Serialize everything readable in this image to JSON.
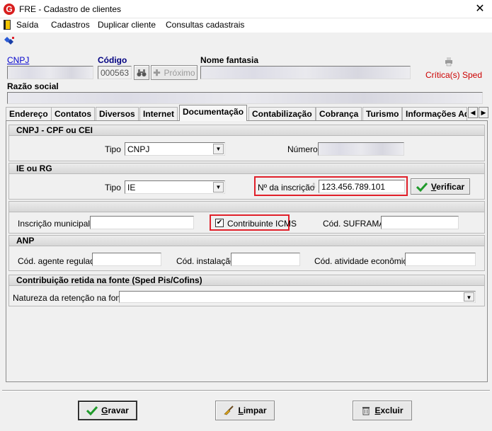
{
  "window": {
    "title": "FRE - Cadastro de clientes",
    "logo_letter": "G",
    "close_glyph": "✕"
  },
  "menu": {
    "items": [
      "Saída",
      "Cadastros",
      "Duplicar cliente",
      "Consultas cadastrais"
    ]
  },
  "header": {
    "cnpj_label": "CNPJ",
    "codigo_label": "Código",
    "codigo_value": "000563",
    "proximo_label": "Próximo",
    "nome_fantasia_label": "Nome fantasia",
    "sped_label": "Crítica(s) Sped",
    "razao_social_label": "Razão social"
  },
  "tabs": [
    {
      "label": "Endereço"
    },
    {
      "label": "Contatos"
    },
    {
      "label": "Diversos"
    },
    {
      "label": "Internet"
    },
    {
      "label": "Documentação"
    },
    {
      "label": "Contabilização"
    },
    {
      "label": "Cobrança"
    },
    {
      "label": "Turismo"
    },
    {
      "label": "Informações Ad"
    }
  ],
  "tab_scroll": {
    "left": "◀",
    "right": "▶"
  },
  "cnpj_section": {
    "title": "CNPJ - CPF ou CEI",
    "tipo_label": "Tipo",
    "tipo_value": "CNPJ",
    "numero_label": "Número"
  },
  "ie_section": {
    "title": "IE ou RG",
    "tipo_label": "Tipo",
    "tipo_value": "IE",
    "inscricao_label": "Nº da inscrição",
    "inscricao_value": "123.456.789.101",
    "verificar_label": "Verificar"
  },
  "misc_section": {
    "inscricao_municipal_label": "Inscrição municipal",
    "contribuinte_label": "Contribuinte ICMS",
    "contribuinte_checked": true,
    "suframa_label": "Cód. SUFRAMA"
  },
  "anp_section": {
    "title": "ANP",
    "agente_label": "Cód. agente regulado",
    "instalacao_label": "Cód. instalação",
    "atividade_label": "Cód. atividade econômica"
  },
  "retencao_section": {
    "title": "Contribuição retida na fonte  (Sped Pis/Cofins)",
    "natureza_label": "Natureza da retenção na fonte"
  },
  "footer": {
    "gravar_label": "Gravar",
    "limpar_label": "Limpar",
    "excluir_label": "Excluir"
  },
  "colors": {
    "accent_red": "#e0202a",
    "sped_red": "#cc0000",
    "check_green": "#1f9a2a"
  }
}
